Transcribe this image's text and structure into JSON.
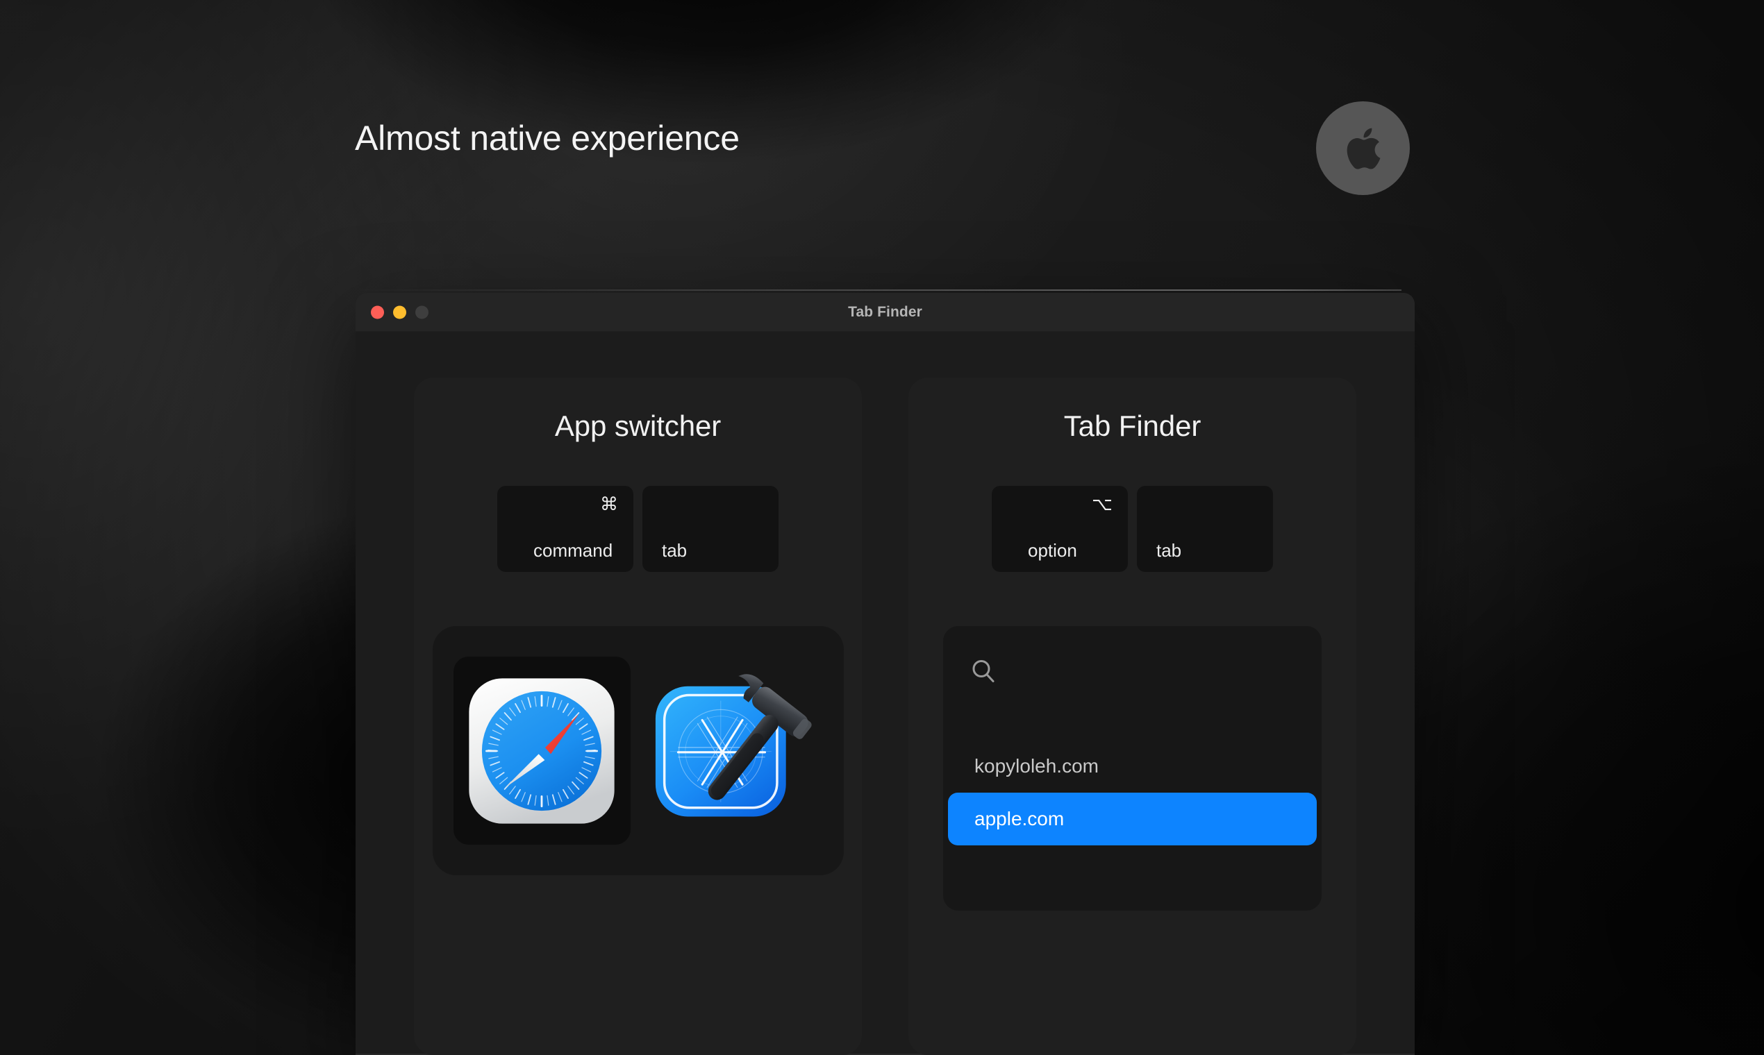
{
  "page": {
    "title": "Almost native experience",
    "background_color": "#1a1a1a",
    "accent_color": "#0d84ff"
  },
  "apple_badge": {
    "icon": "apple-logo-icon",
    "background_color": "#565656",
    "logo_color": "#272727"
  },
  "window": {
    "title": "Tab Finder",
    "traffic_lights": [
      {
        "name": "close",
        "color": "#ff5f57"
      },
      {
        "name": "minimize",
        "color": "#ffbd2e"
      },
      {
        "name": "maximize",
        "color": "#3e3e3e"
      }
    ],
    "background_color": "#1c1c1c",
    "titlebar_color": "#252525"
  },
  "cards": [
    {
      "id": "app-switcher",
      "title": "App switcher",
      "shortcut": [
        {
          "glyph": "⌘",
          "label": "command",
          "icon": "command-key-icon"
        },
        {
          "glyph": "",
          "label": "tab",
          "icon": "tab-key-icon"
        }
      ],
      "apps": [
        {
          "name": "Safari",
          "icon": "safari-app-icon",
          "selected": true
        },
        {
          "name": "Xcode",
          "icon": "xcode-app-icon",
          "selected": false
        }
      ]
    },
    {
      "id": "tab-finder",
      "title": "Tab Finder",
      "shortcut": [
        {
          "glyph": "⌥",
          "label": "option",
          "icon": "option-key-icon"
        },
        {
          "glyph": "",
          "label": "tab",
          "icon": "tab-key-icon"
        }
      ],
      "search": {
        "icon": "search-icon",
        "value": "",
        "placeholder": ""
      },
      "results": [
        {
          "label": "kopyloleh.com",
          "selected": false
        },
        {
          "label": "apple.com",
          "selected": true
        }
      ]
    }
  ]
}
